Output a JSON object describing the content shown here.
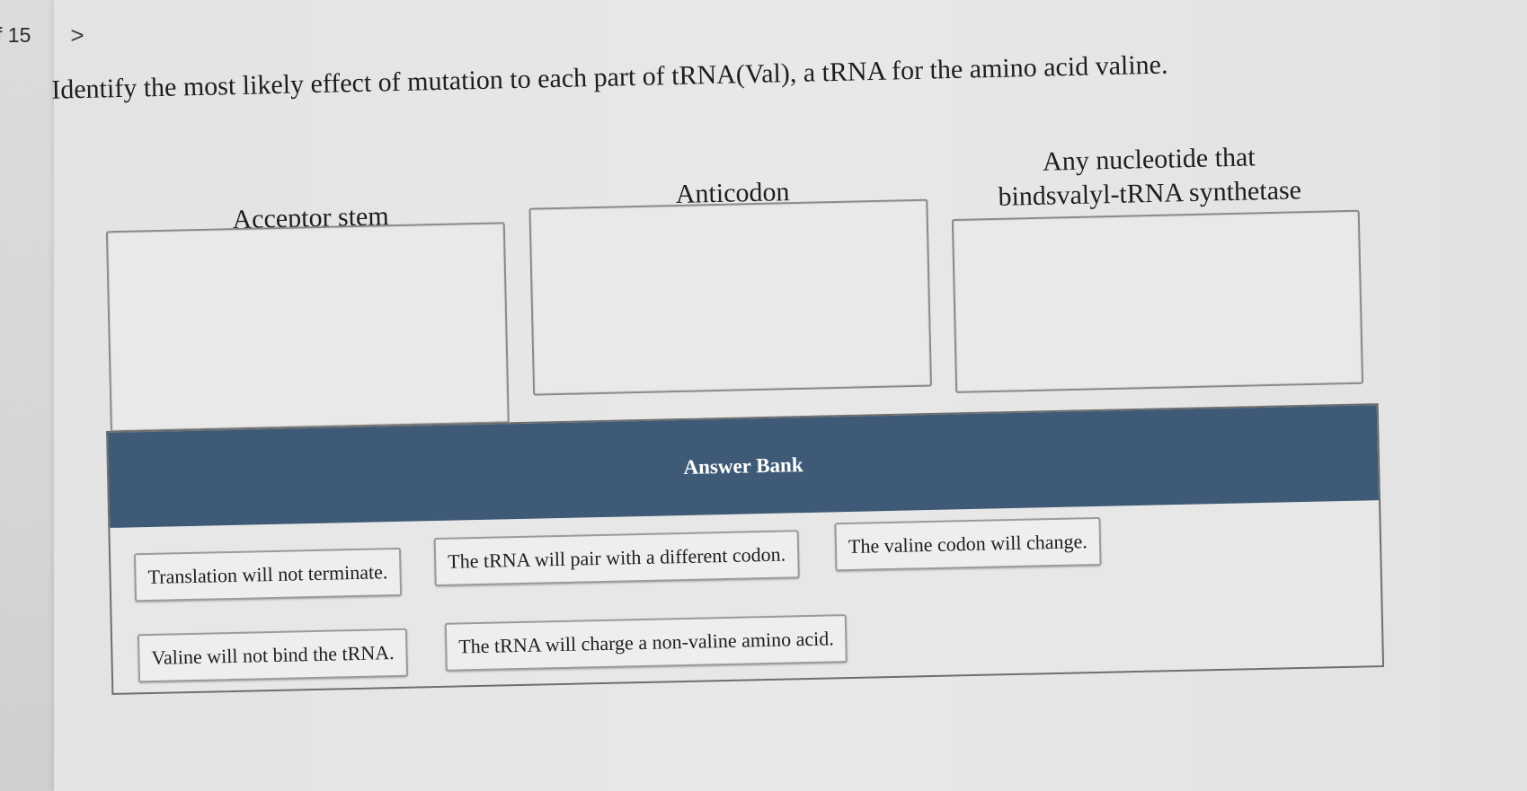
{
  "nav": {
    "counter": "f 15",
    "next_symbol": ">"
  },
  "question": "Identify the most likely effect of mutation to each part of tRNA(Val), a tRNA for the amino acid valine.",
  "targets": [
    {
      "label_lines": [
        "Acceptor stem"
      ]
    },
    {
      "label_lines": [
        "Anticodon"
      ]
    },
    {
      "label_lines": [
        "Any nucleotide that",
        "bindsvalyl-tRNA synthetase"
      ]
    }
  ],
  "answer_bank": {
    "title": "Answer Bank",
    "items": [
      "Translation will not terminate.",
      "The tRNA will pair with a different codon.",
      "The valine codon will change.",
      "Valine will not bind the tRNA.",
      "The tRNA will charge a non-valine amino acid."
    ]
  },
  "colors": {
    "bank_header": "#3f5a76",
    "background": "#e6e6e6"
  }
}
